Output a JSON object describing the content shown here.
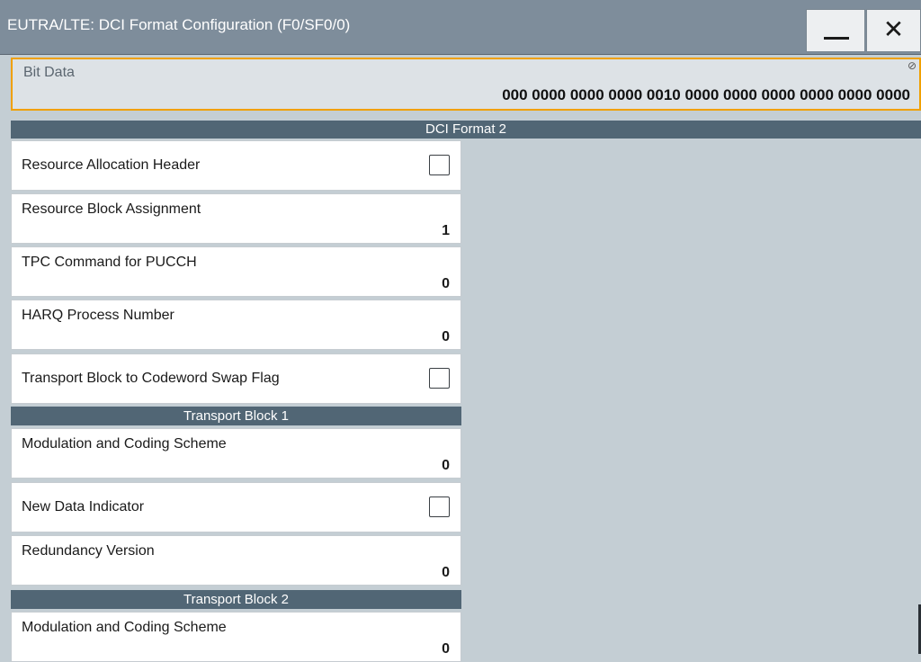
{
  "window": {
    "title": "EUTRA/LTE: DCI Format Configuration (F0/SF0/0)",
    "minimize_icon": "minimize-icon",
    "close_icon": "close-icon",
    "close_glyph": "✕"
  },
  "bit_data": {
    "label": "Bit Data",
    "value": "000 0000 0000 0000 0010 0000 0000 0000 0000 0000 0000",
    "edit_icon": "edit-icon",
    "edit_glyph": "⊘"
  },
  "section": {
    "title": "DCI Format 2"
  },
  "fields": {
    "resource_allocation_header": {
      "label": "Resource Allocation Header",
      "checked": false
    },
    "resource_block_assignment": {
      "label": "Resource Block Assignment",
      "value": "1"
    },
    "tpc_command_pucch": {
      "label": "TPC Command for PUCCH",
      "value": "0"
    },
    "harq_process_number": {
      "label": "HARQ Process Number",
      "value": "0"
    },
    "tb_codeword_swap_flag": {
      "label": "Transport Block to Codeword Swap Flag",
      "checked": false
    }
  },
  "transport_block_1": {
    "title": "Transport Block 1",
    "mcs": {
      "label": "Modulation and Coding Scheme",
      "value": "0"
    },
    "new_data_indicator": {
      "label": "New Data Indicator",
      "checked": false
    },
    "redundancy_version": {
      "label": "Redundancy Version",
      "value": "0"
    }
  },
  "transport_block_2": {
    "title": "Transport Block 2",
    "mcs": {
      "label": "Modulation and Coding Scheme",
      "value": "0"
    }
  },
  "colors": {
    "titlebar": "#7e8d9b",
    "section_header": "#516675",
    "background": "#c4ced4",
    "focus_border": "#f0a000"
  }
}
